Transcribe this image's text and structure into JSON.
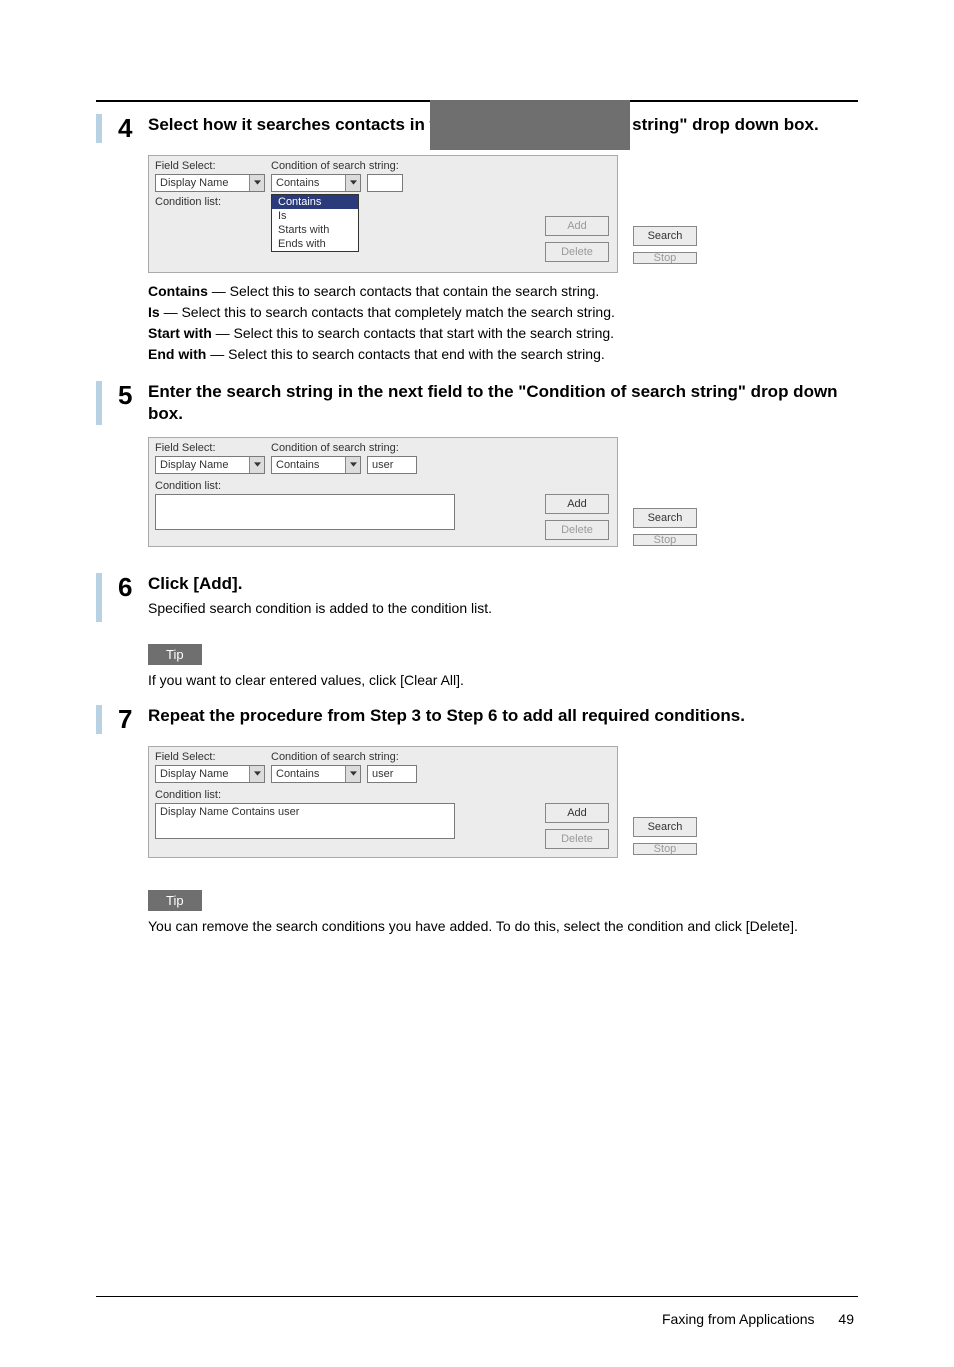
{
  "steps": {
    "s4": {
      "num": "4",
      "title": "Select how it searches contacts in the \"Condition of search string\" drop down box.",
      "ui": {
        "field_select_label": "Field Select:",
        "field_select_value": "Display Name",
        "condition_label": "Condition of search string:",
        "condition_value": "Contains",
        "condition_list_label": "Condition list:",
        "add_btn": "Add",
        "delete_btn": "Delete",
        "search_btn": "Search",
        "stop_btn": "Stop",
        "options": {
          "o1": "Contains",
          "o2": "Is",
          "o3": "Starts with",
          "o4": "Ends with"
        }
      },
      "defs": {
        "d1_b": "Contains",
        "d1_t": " — Select this to search contacts that contain the search string.",
        "d2_b": "Is",
        "d2_t": " — Select this to search contacts that completely match the search string.",
        "d3_b": "Start with",
        "d3_t": " — Select this to search contacts that start with the search string.",
        "d4_b": "End with",
        "d4_t": " — Select this to search contacts that end with the search string."
      }
    },
    "s5": {
      "num": "5",
      "title": "Enter the search string in the next field to the \"Condition of search string\" drop down box.",
      "ui": {
        "field_select_label": "Field Select:",
        "field_select_value": "Display Name",
        "condition_label": "Condition of search string:",
        "condition_value": "Contains",
        "input_value": "user",
        "condition_list_label": "Condition list:",
        "add_btn": "Add",
        "delete_btn": "Delete",
        "search_btn": "Search",
        "stop_btn": "Stop"
      }
    },
    "s6": {
      "num": "6",
      "title": "Click [Add].",
      "sub": "Specified search condition is added to the condition list.",
      "tip_label": "Tip",
      "tip_text": "If you want to clear entered values, click [Clear All]."
    },
    "s7": {
      "num": "7",
      "title": "Repeat the procedure from Step 3 to Step 6 to add all required conditions.",
      "ui": {
        "field_select_label": "Field Select:",
        "field_select_value": "Display Name",
        "condition_label": "Condition of search string:",
        "condition_value": "Contains",
        "input_value": "user",
        "condition_list_label": "Condition list:",
        "list_item": "Display Name Contains user",
        "add_btn": "Add",
        "delete_btn": "Delete",
        "search_btn": "Search",
        "stop_btn": "Stop"
      },
      "tip_label": "Tip",
      "tip_text": "You can remove the search conditions you have added. To do this, select the condition and click [Delete]."
    }
  },
  "footer": {
    "section": "Faxing from Applications",
    "page": "49"
  }
}
